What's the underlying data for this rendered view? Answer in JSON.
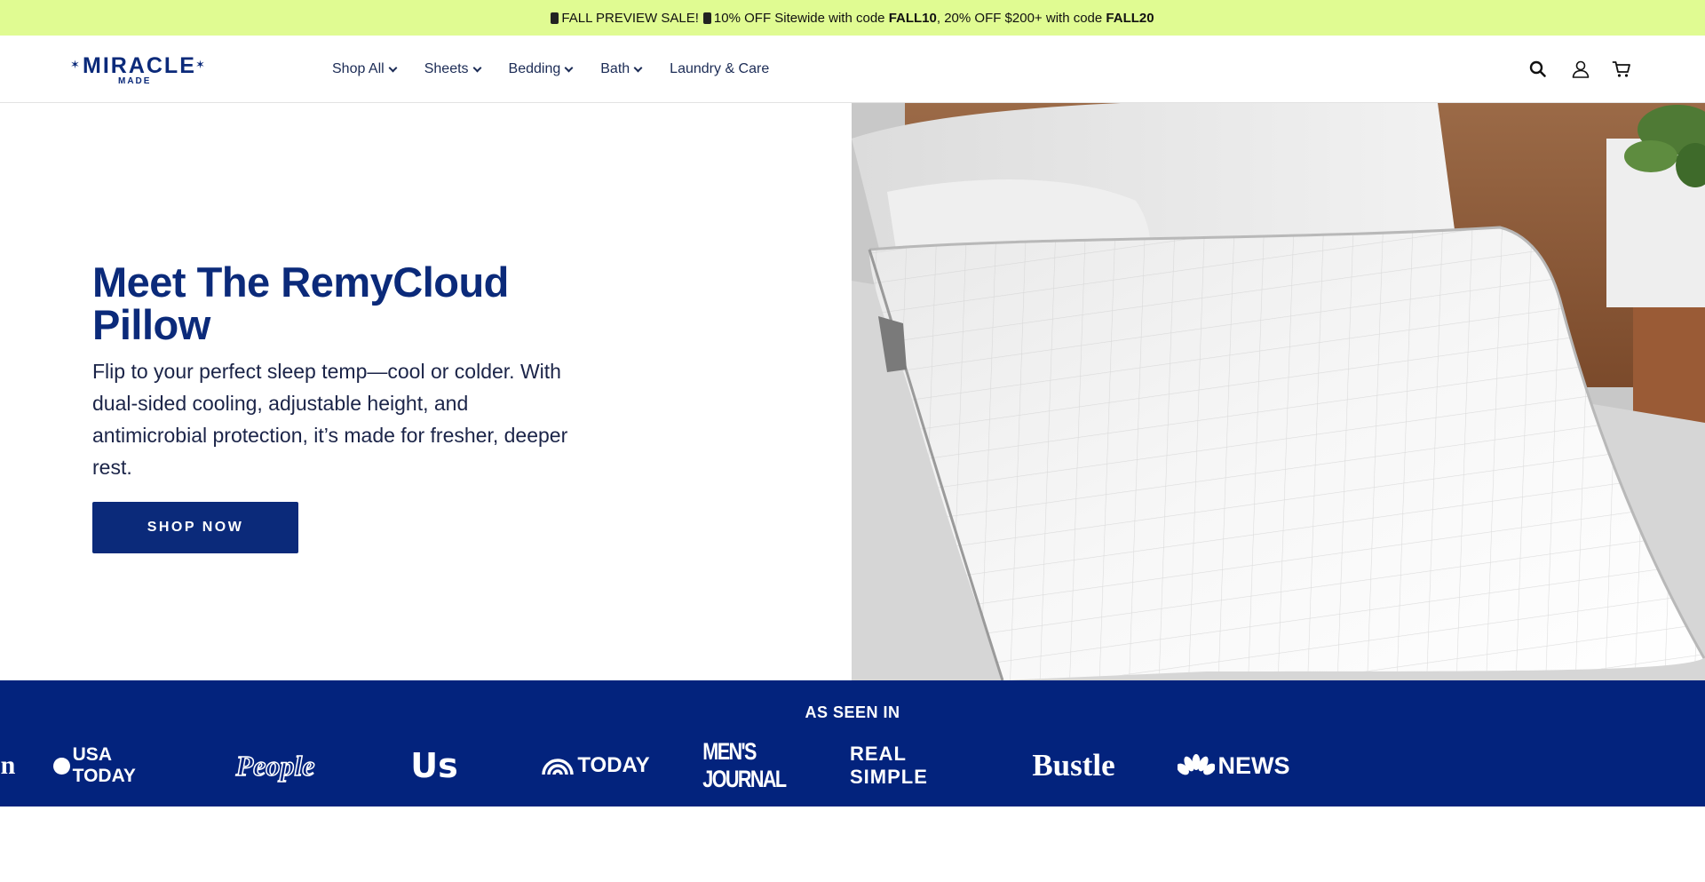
{
  "announcement": {
    "lead": "FALL PREVIEW SALE!",
    "mid": "10% OFF Sitewide with code ",
    "code1": "FALL10",
    "sep": ", 20% OFF $200+ with code ",
    "code2": "FALL20"
  },
  "header": {
    "logo_word": "MIRACLE",
    "logo_sub": "MADE",
    "nav": [
      {
        "label": "Shop All"
      },
      {
        "label": "Sheets"
      },
      {
        "label": "Bedding"
      },
      {
        "label": "Bath"
      },
      {
        "label": "Laundry & Care"
      }
    ]
  },
  "hero": {
    "title_line1": "Meet The RemyCloud",
    "title_line2": "Pillow",
    "body": "Flip to your perfect sleep temp—cool or colder. With dual-sided cooling, adjustable height, and antimicrobial protection, it’s made for fresher, deeper rest.",
    "cta": "SHOP NOW"
  },
  "press": {
    "title": "AS SEEN IN",
    "logos": [
      "n",
      "USA TODAY",
      "People",
      "Us",
      "TODAY",
      "MEN'S JOURNAL",
      "REAL SIMPLE",
      "Bustle",
      "NEWS"
    ]
  },
  "colors": {
    "announcement_bg": "#e0fb92",
    "brand_navy": "#0b2a7a",
    "press_bg": "#03237d"
  }
}
